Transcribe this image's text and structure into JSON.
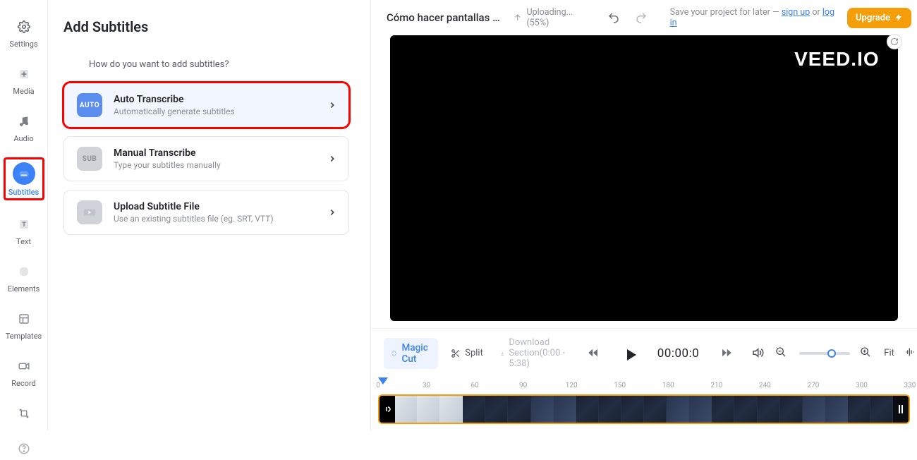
{
  "sidebar": {
    "items": [
      {
        "label": "Settings"
      },
      {
        "label": "Media"
      },
      {
        "label": "Audio"
      },
      {
        "label": "Subtitles"
      },
      {
        "label": "Text"
      },
      {
        "label": "Elements"
      },
      {
        "label": "Templates"
      },
      {
        "label": "Record"
      },
      {
        "label": "Resize"
      },
      {
        "label": "Help"
      }
    ]
  },
  "panel": {
    "title": "Add Subtitles",
    "question": "How do you want to add subtitles?",
    "options": [
      {
        "badge": "AUTO",
        "title": "Auto Transcribe",
        "desc": "Automatically generate subtitles"
      },
      {
        "badge": "SUB",
        "title": "Manual Transcribe",
        "desc": "Type your subtitles manually"
      },
      {
        "badge": "",
        "title": "Upload Subtitle File",
        "desc": "Use an existing subtitles file (eg. SRT, VTT)"
      }
    ]
  },
  "topbar": {
    "project_title": "Cómo hacer pantallas fi...",
    "upload_status": "Uploading... (55%)",
    "save_prompt_prefix": "Save your project for later —",
    "sign_up": "sign up",
    "or": "or",
    "log_in": "log in",
    "upgrade": "Upgrade"
  },
  "preview": {
    "brand": "VEED.IO"
  },
  "toolbar": {
    "magic_cut": "Magic Cut",
    "split": "Split",
    "download_section": "Download Section(0:00 - 5:38)",
    "timecode": "00:00:0",
    "fit": "Fit"
  },
  "ruler": {
    "ticks": [
      "0",
      "30",
      "60",
      "90",
      "120",
      "150",
      "180",
      "210",
      "240",
      "270",
      "300",
      "330"
    ]
  }
}
